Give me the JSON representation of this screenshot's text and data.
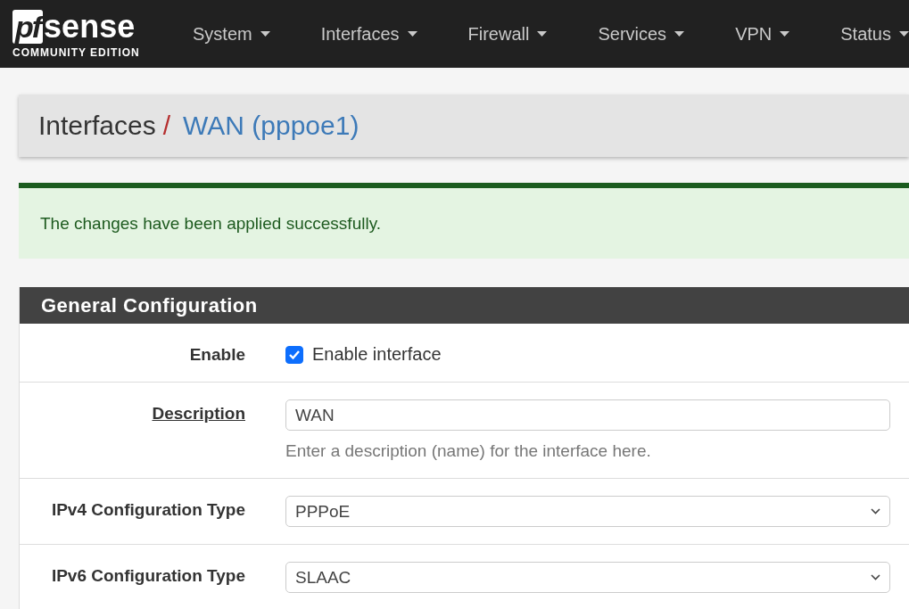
{
  "brand": {
    "mark": "pf",
    "name": "sense",
    "edition": "COMMUNITY EDITION"
  },
  "nav": [
    {
      "label": "System"
    },
    {
      "label": "Interfaces"
    },
    {
      "label": "Firewall"
    },
    {
      "label": "Services"
    },
    {
      "label": "VPN"
    },
    {
      "label": "Status"
    }
  ],
  "breadcrumb": {
    "parent": "Interfaces",
    "separator": "/",
    "current": "WAN (pppoe1)"
  },
  "alert": {
    "message": "The changes have been applied successfully."
  },
  "panel": {
    "title": "General Configuration",
    "rows": [
      {
        "kind": "checkbox",
        "label": "Enable",
        "label_link": false,
        "checked": true,
        "text": "Enable interface"
      },
      {
        "kind": "text",
        "label": "Description",
        "label_link": true,
        "value": "WAN",
        "help": "Enter a description (name) for the interface here."
      },
      {
        "kind": "select",
        "label": "IPv4 Configuration Type",
        "label_link": false,
        "value": "PPPoE"
      },
      {
        "kind": "select",
        "label": "IPv6 Configuration Type",
        "label_link": false,
        "value": "SLAAC"
      }
    ]
  }
}
